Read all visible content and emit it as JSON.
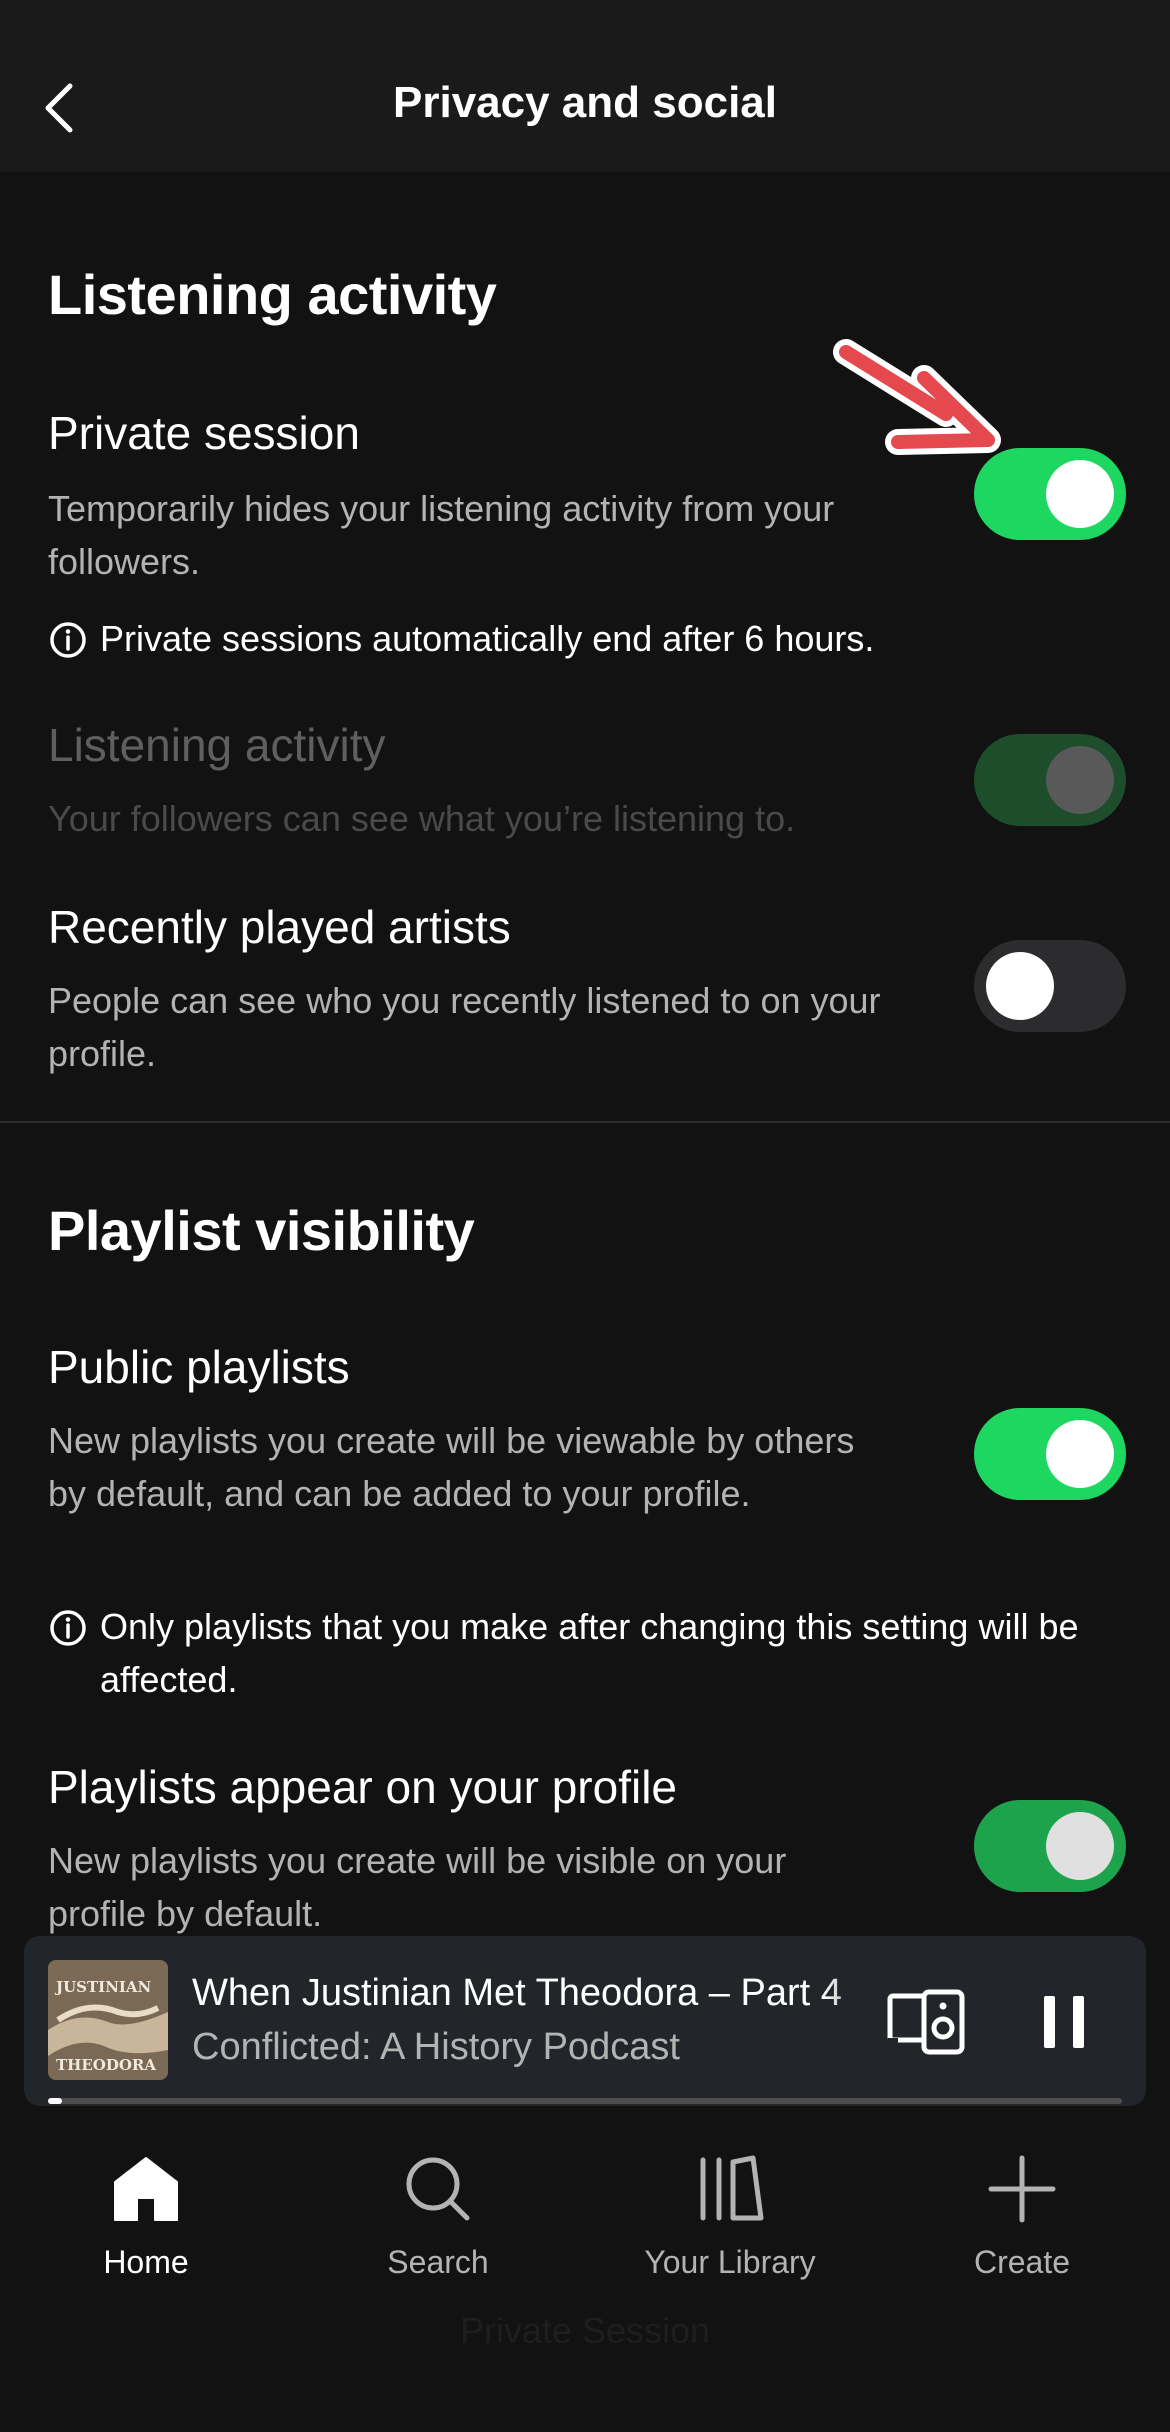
{
  "header": {
    "title": "Privacy and social"
  },
  "listening_activity_section": {
    "title": "Listening activity",
    "private_session": {
      "title": "Private session",
      "description": "Temporarily hides your listening activity from your followers.",
      "toggle": "on",
      "note": "Private sessions automatically end after 6 hours."
    },
    "listening_activity": {
      "title": "Listening activity",
      "description": "Your followers can see what you’re listening to.",
      "toggle": "on (disabled)"
    },
    "recently_played": {
      "title": "Recently played artists",
      "description": "People can see who you recently listened to on your profile.",
      "toggle": "off"
    }
  },
  "playlist_section": {
    "title": "Playlist visibility",
    "public_playlists": {
      "title": "Public playlists",
      "description": "New playlists you create will be viewable by others by default, and can be added to your profile.",
      "toggle": "on",
      "note": "Only playlists that you make after changing this setting will be affected."
    },
    "playlists_on_profile": {
      "title": "Playlists appear on your profile",
      "description": "New playlists you create will be visible on your profile by default.",
      "toggle": "on"
    }
  },
  "now_playing": {
    "title": "When Justinian Met Theodora – Part 4",
    "subtitle": "Conflicted: A History Podcast",
    "cover_text_top": "JUSTINIAN",
    "cover_text_bottom": "THEODORA",
    "progress_fraction": 0.01
  },
  "nav": {
    "home": "Home",
    "search": "Search",
    "library": "Your Library",
    "create": "Create"
  },
  "status_label": "Private Session",
  "colors": {
    "accent_green": "#1ed760",
    "background": "#121212",
    "annotation_arrow": "#e5484d"
  }
}
